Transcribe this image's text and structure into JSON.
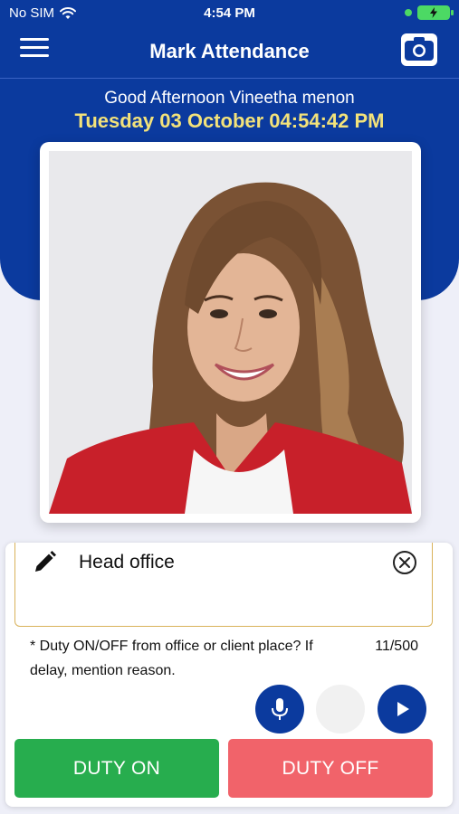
{
  "status": {
    "carrier": "No SIM",
    "time": "4:54 PM",
    "battery_color": "#4cd964"
  },
  "nav": {
    "title": "Mark Attendance",
    "menu_icon": "hamburger-menu-icon",
    "camera_icon": "camera-icon"
  },
  "greeting": {
    "text": "Good Afternoon Vineetha menon",
    "datetime": "Tuesday 03 October 04:54:42 PM"
  },
  "photo": {
    "description_icon": "user-photo"
  },
  "remark": {
    "value": "Head office",
    "hint": "* Duty ON/OFF from office or client place? If delay, mention reason.",
    "counter": "11/500"
  },
  "actions": {
    "duty_on": "DUTY ON",
    "duty_off": "DUTY OFF"
  },
  "colors": {
    "primary": "#0b3a9e",
    "accent_yellow": "#f3e27a",
    "duty_on": "#27ad4e",
    "duty_off": "#f1636a"
  }
}
